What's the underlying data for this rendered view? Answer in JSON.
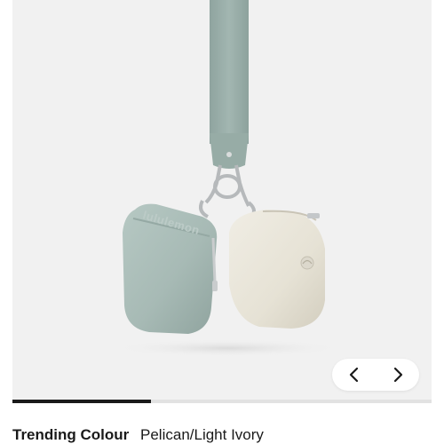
{
  "product": {
    "image_alt": "Dual Pouch Wristlet",
    "logo_text": "lululemon"
  },
  "gallery": {
    "progress_fraction": 0.33,
    "prev_icon": "chevron-left-icon",
    "next_icon": "chevron-right-icon"
  },
  "swatch": {
    "label": "Trending Colour",
    "value": "Pelican/Light Ivory"
  },
  "colors": {
    "strap": "#9fb3ae",
    "left_pouch": "#a9bcb8",
    "right_pouch": "#e8e4d8",
    "hardware": "#b9bcbe",
    "background": "#f1f1f1",
    "accent": "#1a1a1a"
  }
}
